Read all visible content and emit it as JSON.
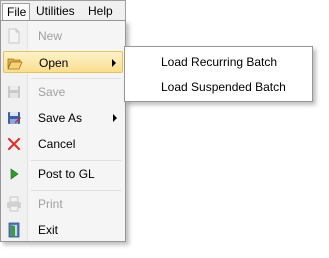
{
  "menubar": {
    "file": "File",
    "utilities": "Utilities",
    "help": "Help"
  },
  "file_menu": {
    "items": [
      {
        "label": "New",
        "icon": "new-document-icon",
        "enabled": false
      },
      {
        "label": "Open",
        "icon": "open-folder-icon",
        "enabled": true,
        "highlighted": true,
        "has_submenu": true
      },
      {
        "label": "Save",
        "icon": "save-icon",
        "enabled": false
      },
      {
        "label": "Save As",
        "icon": "save-as-icon",
        "enabled": true,
        "has_submenu": true
      },
      {
        "label": "Cancel",
        "icon": "cancel-icon",
        "enabled": true
      },
      {
        "label": "Post to GL",
        "icon": "post-icon",
        "enabled": true
      },
      {
        "label": "Print",
        "icon": "print-icon",
        "enabled": false
      },
      {
        "label": "Exit",
        "icon": "exit-icon",
        "enabled": true
      }
    ]
  },
  "open_submenu": {
    "items": [
      {
        "label": "Load Recurring Batch"
      },
      {
        "label": "Load Suspended Batch"
      }
    ]
  },
  "colors": {
    "highlight_top": "#fdf2c9",
    "highlight_bottom": "#fbdf8f",
    "disabled_text": "#a0a0a0",
    "cancel_red": "#d9352b",
    "post_green": "#2e9c2e"
  }
}
